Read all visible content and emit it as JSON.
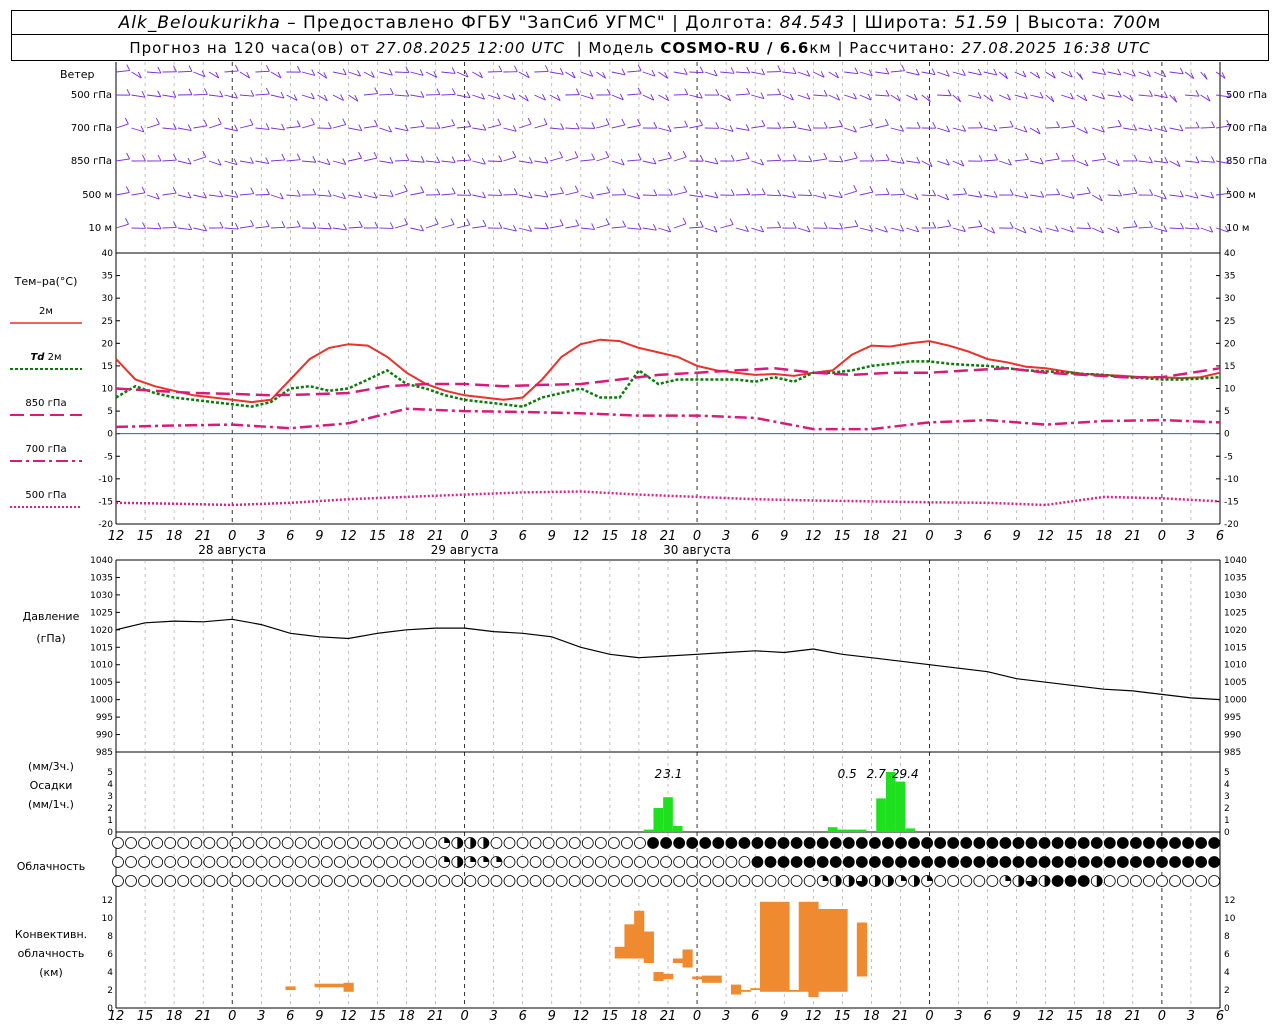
{
  "header": {
    "station": "Alk_Beloukurikha",
    "provided": "– Предоставлено ФГБУ \"ЗапСиб УГМС\"",
    "lon_label": "Долгота:",
    "lon": "84.543",
    "lat_label": "Широта:",
    "lat": "51.59",
    "alt_label": "Высота:",
    "alt": "700",
    "alt_unit": "м",
    "forecast_prefix": "Прогноз на 120 часа(ов) от",
    "forecast_from": "27.08.2025 12:00 UTC",
    "model_label": "Модель",
    "model": "COSMO-RU / 6.6",
    "model_unit": "км",
    "computed_label": "Рассчитано:",
    "computed": "27.08.2025 16:38 UTC"
  },
  "labels": {
    "wind": "Ветер",
    "wind_levels": [
      "500 гПа",
      "700 гПа",
      "850 гПа",
      "500 м",
      "10 м"
    ],
    "temp_title": "Тем–ра(°С)",
    "t2m": "2м",
    "td": "Td",
    "td_suffix": "2м",
    "t850": "850 гПа",
    "t700": "700 гПа",
    "t500": "500 гПа",
    "pressure": "Давление",
    "pressure_unit": "(гПа)",
    "precip_u1": "(мм/3ч.)",
    "precip": "Осадки",
    "precip_u2": "(мм/1ч.)",
    "cloud": "Облачность",
    "conv1": "Конвективн.",
    "conv2": "облачность",
    "conv3": "(км)"
  },
  "colors": {
    "t2m": "#e8322a",
    "td": "#0a7a0a",
    "t850": "#d81b7a",
    "t500": "#e0208a",
    "wind": "#7a2be0",
    "precip": "#1ee01e",
    "conv": "#f08a30",
    "zero_line": "#3030d0"
  },
  "chart_data": [
    {
      "type": "line",
      "name": "temperature",
      "x_hours_from_start": [
        0,
        3,
        6,
        9,
        12,
        15,
        18,
        21,
        24,
        27,
        30,
        33,
        36,
        39,
        42,
        45,
        48,
        51,
        54,
        57,
        60,
        63,
        66,
        69,
        72,
        75,
        78,
        81,
        84,
        87,
        90,
        93,
        96,
        99,
        102,
        105,
        108,
        111,
        114
      ],
      "x_tick_labels": [
        "12",
        "15",
        "18",
        "21",
        "0",
        "3",
        "6",
        "9",
        "12",
        "15",
        "18",
        "21",
        "0",
        "3",
        "6",
        "9",
        "12",
        "15",
        "18",
        "21",
        "0",
        "3",
        "6",
        "9",
        "12",
        "15",
        "18",
        "21",
        "0",
        "3",
        "6",
        "9",
        "12",
        "15",
        "18",
        "21",
        "0",
        "3",
        "6",
        "9",
        "12",
        "15",
        "18"
      ],
      "date_labels": [
        "28 августа",
        "29 августа",
        "30 августа"
      ],
      "ylim": [
        -20,
        40
      ],
      "y_ticks": [
        -20,
        -15,
        -10,
        -5,
        0,
        5,
        10,
        15,
        20,
        25,
        30,
        35,
        40
      ],
      "series": [
        {
          "name": "2м",
          "x": [
            0,
            2,
            4,
            6,
            8,
            10,
            12,
            14,
            16,
            18,
            20,
            22,
            24,
            26,
            28,
            30,
            32,
            34,
            36,
            38,
            40,
            42,
            44,
            46,
            48,
            50,
            52,
            54,
            56,
            58,
            60,
            62,
            64,
            66,
            68,
            70,
            72,
            74,
            76,
            78,
            80,
            82,
            84,
            86,
            88,
            90,
            92,
            94,
            96,
            98,
            100,
            102,
            104,
            106,
            108,
            110,
            112,
            114
          ],
          "values": [
            16.5,
            12,
            10.5,
            9.5,
            8.5,
            8,
            7.5,
            7,
            7.5,
            12,
            16.5,
            19,
            19.8,
            19.5,
            17,
            13.5,
            11,
            9.5,
            8.5,
            8,
            7.5,
            8,
            12,
            17,
            19.8,
            20.8,
            20.5,
            19,
            18,
            17,
            15,
            14,
            13.5,
            13,
            13.2,
            12.8,
            13.5,
            14,
            17.5,
            19.5,
            19.3,
            20,
            20.5,
            19.5,
            18.2,
            16.5,
            15.8,
            14.8,
            14.5,
            13.8,
            13.2,
            13,
            12.8,
            12.5,
            12.5,
            12.3,
            12.5,
            13.5
          ]
        },
        {
          "name": "Td 2м",
          "x": [
            0,
            2,
            4,
            6,
            8,
            10,
            12,
            14,
            16,
            18,
            20,
            22,
            24,
            26,
            28,
            30,
            32,
            34,
            36,
            38,
            40,
            42,
            44,
            46,
            48,
            50,
            52,
            54,
            56,
            58,
            60,
            62,
            64,
            66,
            68,
            70,
            72,
            74,
            76,
            78,
            80,
            82,
            84,
            86,
            88,
            90,
            92,
            94,
            96,
            98,
            100,
            102,
            104,
            106,
            108,
            110,
            112,
            114
          ],
          "values": [
            8,
            10.5,
            9,
            8,
            7.5,
            7,
            6.5,
            6,
            7,
            10,
            10.5,
            9.5,
            10,
            12,
            14,
            11,
            10,
            8.5,
            7.5,
            7,
            6.5,
            6,
            8,
            9,
            10,
            8,
            8,
            14,
            11,
            12,
            12,
            12,
            12,
            11.5,
            12.5,
            11.5,
            13.5,
            13.5,
            14,
            15,
            15.5,
            16,
            16,
            15.5,
            15.2,
            15,
            14.5,
            14,
            13.8,
            13.5,
            13.2,
            13,
            12.5,
            12.3,
            12,
            12,
            12.2,
            12.5
          ]
        },
        {
          "name": "850 гПа",
          "x": [
            0,
            4,
            8,
            12,
            16,
            20,
            24,
            28,
            32,
            36,
            40,
            44,
            48,
            52,
            56,
            60,
            64,
            68,
            72,
            76,
            80,
            84,
            88,
            92,
            96,
            100,
            104,
            108,
            112,
            114
          ],
          "values": [
            10,
            9.5,
            9,
            8.8,
            8.5,
            8.7,
            9,
            10.5,
            11,
            11,
            10.5,
            10.8,
            11,
            12,
            13,
            13.5,
            14,
            14.5,
            13.5,
            13,
            13.5,
            13.5,
            14,
            14.5,
            13.5,
            13,
            12.5,
            12.5,
            13.8,
            14.5
          ]
        },
        {
          "name": "700 гПа",
          "x": [
            0,
            6,
            12,
            18,
            24,
            30,
            36,
            42,
            48,
            54,
            60,
            66,
            72,
            78,
            84,
            90,
            96,
            102,
            108,
            114
          ],
          "values": [
            1.5,
            1.8,
            2,
            1.2,
            2.3,
            5.5,
            5,
            4.8,
            4.5,
            4,
            4,
            3.5,
            1,
            1,
            2.5,
            3,
            2,
            2.8,
            3,
            2.5
          ]
        },
        {
          "name": "500 гПа",
          "x": [
            0,
            6,
            12,
            18,
            24,
            30,
            36,
            42,
            48,
            54,
            60,
            66,
            72,
            78,
            84,
            90,
            96,
            102,
            108,
            114
          ],
          "values": [
            -15.3,
            -15.5,
            -15.8,
            -15.3,
            -14.5,
            -14,
            -13.5,
            -13,
            -12.8,
            -13.5,
            -14,
            -14.5,
            -14.8,
            -15,
            -15.2,
            -15.3,
            -15.8,
            -14,
            -14.3,
            -15
          ]
        }
      ]
    },
    {
      "type": "line",
      "name": "pressure",
      "ylim": [
        985,
        1040
      ],
      "y_ticks": [
        985,
        990,
        995,
        1000,
        1005,
        1010,
        1015,
        1020,
        1025,
        1030,
        1035,
        1040
      ],
      "x": [
        0,
        3,
        6,
        9,
        12,
        15,
        18,
        21,
        24,
        27,
        30,
        33,
        36,
        39,
        42,
        45,
        48,
        51,
        54,
        57,
        60,
        63,
        66,
        69,
        72,
        75,
        78,
        81,
        84,
        87,
        90,
        93,
        96,
        99,
        102,
        105,
        108,
        111,
        114
      ],
      "values": [
        1020,
        1022,
        1022.5,
        1022.3,
        1023,
        1021.5,
        1019,
        1018,
        1017.5,
        1019,
        1020,
        1020.5,
        1020.5,
        1019.5,
        1019,
        1018,
        1015,
        1013,
        1012,
        1012.5,
        1013,
        1013.5,
        1014,
        1013.5,
        1014.5,
        1013,
        1012,
        1011,
        1010,
        1009,
        1008,
        1006,
        1005,
        1004,
        1003,
        1002.5,
        1001.5,
        1000.5,
        1000
      ]
    },
    {
      "type": "bar",
      "name": "precipitation",
      "ylim": [
        0,
        5
      ],
      "y_ticks": [
        0,
        1,
        2,
        3,
        4,
        5
      ],
      "x": [
        55,
        56,
        57,
        58,
        59,
        74,
        75,
        76,
        77,
        78,
        79,
        80,
        81,
        82,
        83,
        84
      ],
      "values": [
        0.2,
        2,
        2.9,
        0.5,
        0,
        0.4,
        0.2,
        0.2,
        0.2,
        0,
        2.8,
        6,
        4.2,
        0.3,
        0,
        0
      ],
      "annotations": [
        {
          "text": "2",
          "x": 56
        },
        {
          "text": "3.1",
          "x": 57.5
        },
        {
          "text": "0.5",
          "x": 75.5
        },
        {
          "text": "2.7",
          "x": 78.5
        },
        {
          "text": "29.4",
          "x": 81.5
        }
      ]
    },
    {
      "type": "bar",
      "name": "convective_cloud",
      "ylim": [
        0,
        12
      ],
      "y_ticks": [
        0,
        2,
        4,
        6,
        8,
        10,
        12
      ],
      "bars": [
        {
          "x": 18,
          "bottom": 2.0,
          "top": 2.4
        },
        {
          "x": 21,
          "bottom": 2.3,
          "top": 2.7
        },
        {
          "x": 22,
          "bottom": 2.3,
          "top": 2.7
        },
        {
          "x": 23,
          "bottom": 2.3,
          "top": 2.7
        },
        {
          "x": 24,
          "bottom": 1.8,
          "top": 2.8
        },
        {
          "x": 52,
          "bottom": 5.5,
          "top": 6.8
        },
        {
          "x": 53,
          "bottom": 5.5,
          "top": 9.3
        },
        {
          "x": 54,
          "bottom": 5.5,
          "top": 10.8
        },
        {
          "x": 55,
          "bottom": 5.0,
          "top": 8.5
        },
        {
          "x": 56,
          "bottom": 3.0,
          "top": 4.0
        },
        {
          "x": 57,
          "bottom": 3.2,
          "top": 3.8
        },
        {
          "x": 58,
          "bottom": 5.0,
          "top": 5.5
        },
        {
          "x": 59,
          "bottom": 4.5,
          "top": 6.5
        },
        {
          "x": 60,
          "bottom": 3.2,
          "top": 3.5
        },
        {
          "x": 61,
          "bottom": 2.8,
          "top": 3.6
        },
        {
          "x": 62,
          "bottom": 2.8,
          "top": 3.6
        },
        {
          "x": 64,
          "bottom": 1.5,
          "top": 2.6
        },
        {
          "x": 65,
          "bottom": 1.8,
          "top": 2.0
        },
        {
          "x": 66,
          "bottom": 2.0,
          "top": 2.2
        },
        {
          "x": 67,
          "bottom": 1.8,
          "top": 11.8
        },
        {
          "x": 68,
          "bottom": 1.8,
          "top": 11.8
        },
        {
          "x": 69,
          "bottom": 1.8,
          "top": 11.8
        },
        {
          "x": 70,
          "bottom": 1.8,
          "top": 2.0
        },
        {
          "x": 71,
          "bottom": 1.8,
          "top": 11.8
        },
        {
          "x": 72,
          "bottom": 1.2,
          "top": 11.8
        },
        {
          "x": 73,
          "bottom": 1.8,
          "top": 11.0
        },
        {
          "x": 74,
          "bottom": 1.8,
          "top": 11.0
        },
        {
          "x": 75,
          "bottom": 1.8,
          "top": 11.0
        },
        {
          "x": 77,
          "bottom": 3.5,
          "top": 9.5
        }
      ]
    },
    {
      "type": "table",
      "name": "cloudiness",
      "rows": [
        "0000000000000000000000000122200000000000044444444444444444444444444444444444444444444",
        "0000000000000000000000000121110000000000000000000444444444444444444444444444444444444",
        "0000000000000000000000000000000000000000000000000000001223221210000012324442000000000"
      ]
    }
  ]
}
